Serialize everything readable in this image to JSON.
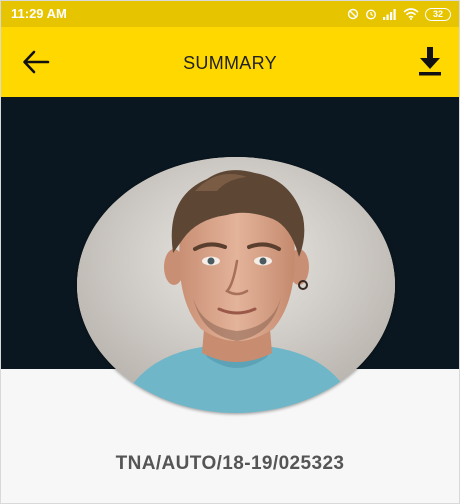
{
  "status_bar": {
    "time": "11:29 AM",
    "battery": "32",
    "icons": [
      "do-not-disturb-icon",
      "alarm-icon",
      "signal-icon",
      "wifi-icon",
      "battery-icon"
    ]
  },
  "app_bar": {
    "title": "SUMMARY",
    "back_icon": "arrow-left-icon",
    "download_icon": "download-icon",
    "color": "#ffd800"
  },
  "profile": {
    "reference_number": "TNA/AUTO/18-19/025323"
  },
  "colors": {
    "hero_background": "#0b1720",
    "page_background": "#f7f7f7",
    "status_bar": "#e7c400"
  }
}
